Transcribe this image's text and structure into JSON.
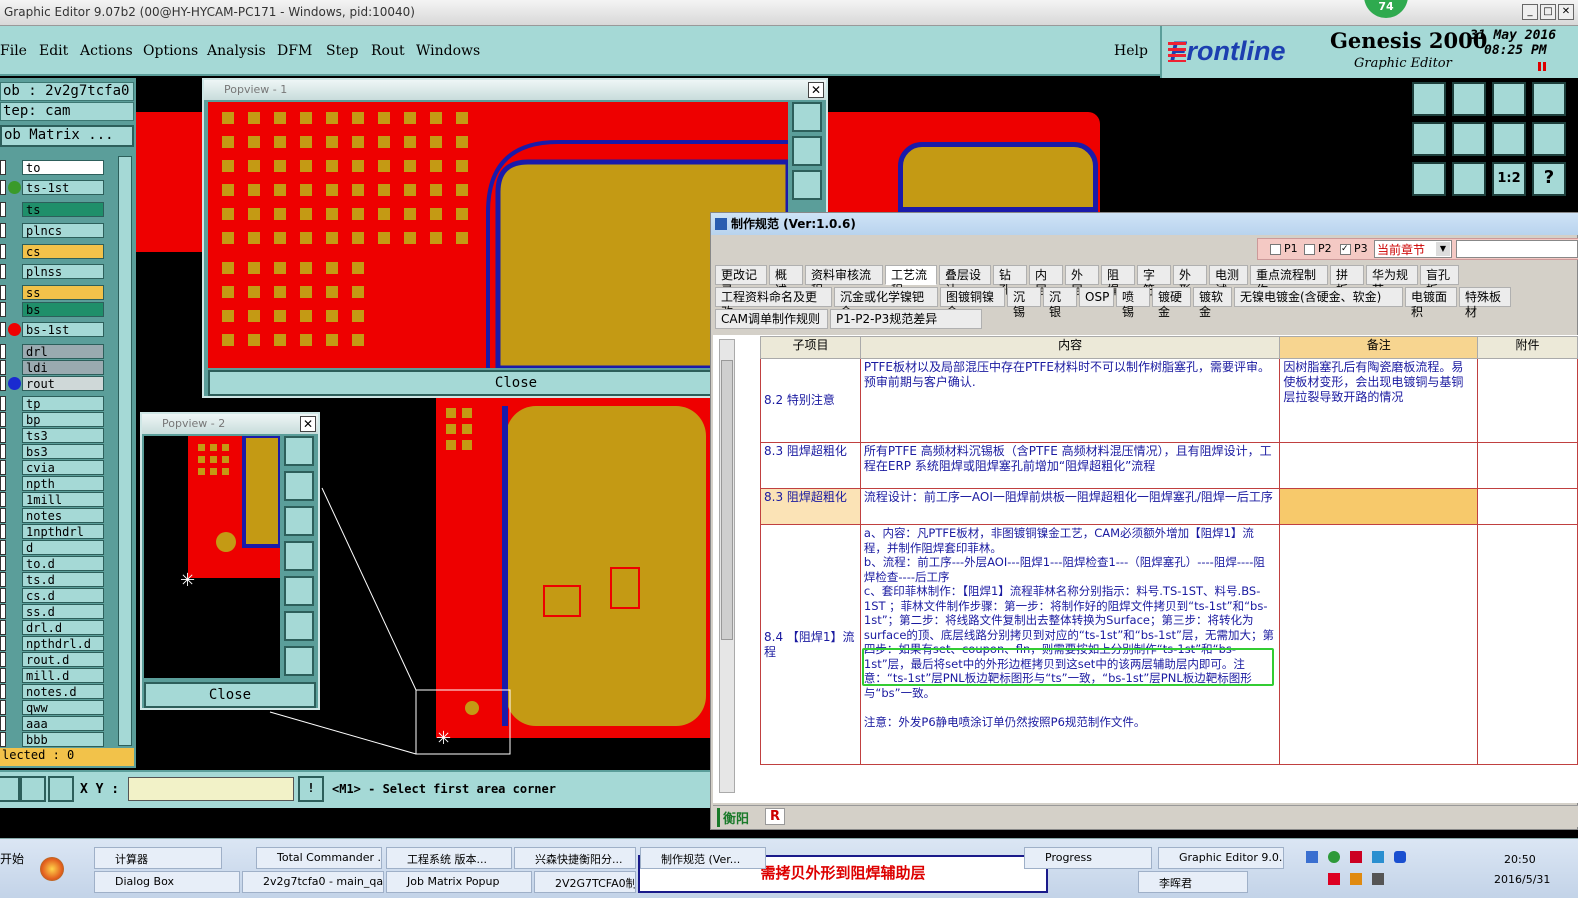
{
  "window": {
    "title": "Graphic Editor 9.07b2 (00@HY-HYCAM-PC171 - Windows, pid:10040)",
    "badge": "74"
  },
  "menu": [
    "File",
    "Edit",
    "Actions",
    "Options",
    "Analysis",
    "DFM",
    "Step",
    "Rout",
    "Windows"
  ],
  "help": "Help",
  "brand": {
    "logo": "Frontline",
    "product": "Genesis 2000",
    "subtitle": "Graphic Editor",
    "date": "31 May 2016",
    "time": "08:25 PM"
  },
  "left": {
    "job": "ob : 2v2g7tcfa0",
    "step": "tep: cam",
    "matrix_button": "ob Matrix ...",
    "layers": [
      {
        "name": "to",
        "color": "#ffffff"
      },
      {
        "name": "ts-1st",
        "color": "#a5d9d6"
      },
      {
        "name": "ts",
        "color": "#1f8f6a"
      },
      {
        "name": "plncs",
        "color": "#a5d9d6"
      },
      {
        "name": "cs",
        "color": "#f2c24a"
      },
      {
        "name": "plnss",
        "color": "#a5d9d6"
      },
      {
        "name": "ss",
        "color": "#f2c24a"
      },
      {
        "name": "bs",
        "color": "#1f8f6a"
      },
      {
        "name": "bs-1st",
        "color": "#a5d9d6"
      },
      {
        "name": "drl",
        "color": "#9aaab0"
      },
      {
        "name": "ldi",
        "color": "#9aaab0"
      },
      {
        "name": "rout",
        "color": "#cfd8d8"
      },
      {
        "name": "tp",
        "color": "#a5d9d6"
      },
      {
        "name": "bp",
        "color": "#a5d9d6"
      },
      {
        "name": "ts3",
        "color": "#a5d9d6"
      },
      {
        "name": "bs3",
        "color": "#a5d9d6"
      },
      {
        "name": "cvia",
        "color": "#a5d9d6"
      },
      {
        "name": "npth",
        "color": "#a5d9d6"
      },
      {
        "name": "1mill",
        "color": "#a5d9d6"
      },
      {
        "name": "notes",
        "color": "#a5d9d6"
      },
      {
        "name": "1npthdrl",
        "color": "#a5d9d6"
      },
      {
        "name": "d",
        "color": "#a5d9d6"
      },
      {
        "name": "to.d",
        "color": "#a5d9d6"
      },
      {
        "name": "ts.d",
        "color": "#a5d9d6"
      },
      {
        "name": "cs.d",
        "color": "#a5d9d6"
      },
      {
        "name": "ss.d",
        "color": "#a5d9d6"
      },
      {
        "name": "drl.d",
        "color": "#a5d9d6"
      },
      {
        "name": "npthdrl.d",
        "color": "#a5d9d6"
      },
      {
        "name": "rout.d",
        "color": "#a5d9d6"
      },
      {
        "name": "mill.d",
        "color": "#a5d9d6"
      },
      {
        "name": "notes.d",
        "color": "#a5d9d6"
      },
      {
        "name": "qww",
        "color": "#a5d9d6"
      },
      {
        "name": "aaa",
        "color": "#a5d9d6"
      },
      {
        "name": "bbb",
        "color": "#a5d9d6"
      }
    ],
    "selected": "lected : 0"
  },
  "popview1": {
    "title": "Popview - 1",
    "close": "Close"
  },
  "popview2": {
    "title": "Popview - 2",
    "close": "Close"
  },
  "cmd": {
    "xy_label": "X Y :",
    "prompt": "<M1> - Select first area corner"
  },
  "spec": {
    "title": "制作规范 (Ver:1.0.6)",
    "filters": [
      "P1",
      "P2",
      "P3"
    ],
    "chapter": "当前章节",
    "tabs_row1": [
      "更改记录",
      "概述",
      "资料审核流程",
      "工艺流程",
      "叠层设计",
      "钻孔",
      "内层",
      "外层",
      "阻焊",
      "字符",
      "外形",
      "电测试",
      "重点流程制作",
      "拼板",
      "华为规范",
      "盲孔板"
    ],
    "tabs_row2": [
      "工程资料命名及更改",
      "沉金或化学镍钯金",
      "图镀铜镍金",
      "沉锡",
      "沉银",
      "OSP",
      "喷锡",
      "镀硬金",
      "镀软金",
      "无镍电镀金(含硬金、软金)",
      "电镀面积",
      "特殊板材"
    ],
    "tabs_row3": [
      "CAM调单制作规则",
      "P1-P2-P3规范差异"
    ],
    "headers": [
      "子项目",
      "内容",
      "备注",
      "附件"
    ],
    "rows": [
      {
        "sub": "8.2 特别注意",
        "content": "PTFE板材以及局部混压中存在PTFE材料时不可以制作树脂塞孔，需要评审。预审前期与客户确认.",
        "note": "因树脂塞孔后有陶瓷磨板流程。易使板材变形，会出现电镀铜与基铜层拉裂导致开路的情况"
      },
      {
        "sub": "8.3 阻焊超粗化",
        "content": "所有PTFE 高频材料沉锡板（含PTFE 高频材料混压情况），且有阻焊设计，工程在ERP 系统阻焊或阻焊塞孔前增加“阻焊超粗化”流程",
        "note": ""
      },
      {
        "sub": "8.3 阻焊超粗化",
        "content": "流程设计：前工序一AOI一阻焊前烘板一阻焊超粗化一阻焊塞孔/阻焊一后工序",
        "note": ""
      },
      {
        "sub": "8.4 【阻焊1】流程",
        "content": "a、内容：凡PTFE板材，非图镀铜镍金工艺，CAM必须额外增加【阻焊1】流程，并制作阻焊套印菲林。\nb、流程：前工序---外层AOI---阻焊1---阻焊检查1---（阻焊塞孔）----阻焊----阻焊检查----后工序\nc、套印菲林制作：【阻焊1】流程菲林名称分别指示：料号.TS-1ST、料号.BS-1ST ；菲林文件制作步骤：第一步：将制作好的阻焊文件拷贝到“ts-1st”和“bs-1st”；第二步：将线路文件复制出去整体转换为Surface；第三步：将转化为surface的顶、底层线路分别拷贝到对应的“ts-1st”和“bs-1st”层，无需加大；第四步：如果有set、coupon、fln，则需要按如上分别制作“ts-1st”和“bs-1st”层，最后将set中的外形边框拷贝到这set中的该两层辅助层内即可。注意：“ts-1st”层PNL板边靶标图形与“ts”一致，“bs-1st”层PNL板边靶标图形与“bs”一致。\n\n注意：外发P6静电喷涂订单仍然按照P6规范制作文件。",
        "note": ""
      }
    ],
    "footer_tab": "衡阳",
    "footer_r": "R"
  },
  "taskbar": {
    "start": "开始",
    "row1": [
      "计算器",
      "Total Commander ...",
      "工程系统 版本...",
      "兴森快捷衡阳分...",
      "制作规范 (Ver...",
      "Progress",
      "Graphic Editor 9.0..."
    ],
    "row2": [
      "Dialog Box",
      "2v2g7tcfa0 - main_qa",
      "Job Matrix Popup",
      "2V2G7TCFA0制",
      "李晖君"
    ],
    "annotation": "需拷贝外形到阻焊辅助层",
    "clock_time": "20:50",
    "clock_date": "2016/5/31"
  }
}
